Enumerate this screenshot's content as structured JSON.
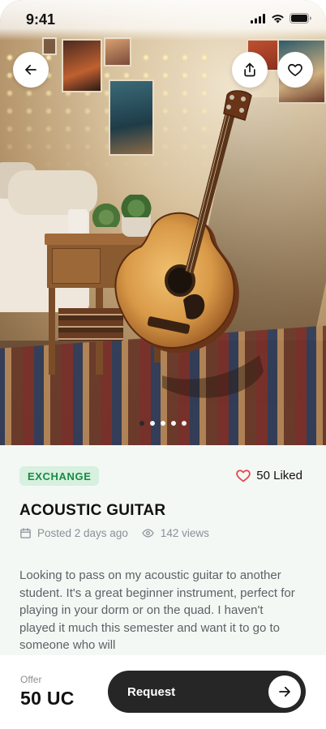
{
  "status_bar": {
    "time": "9:41"
  },
  "hero": {
    "image_subject": "acoustic guitar leaning against a dorm room wall",
    "carousel": {
      "count": 5,
      "active_index": 0
    },
    "icons": {
      "back": "arrow-left-icon",
      "share": "share-icon",
      "favorite": "heart-icon"
    }
  },
  "listing": {
    "badge": "EXCHANGE",
    "liked_label": "50 Liked",
    "title": "ACOUSTIC GUITAR",
    "posted": "Posted 2 days ago",
    "views": "142 views",
    "description": "Looking to pass on my acoustic guitar to another student. It's a great beginner instrument, perfect for playing in your dorm or on the quad. I haven't played it much this semester and want it to go to someone who will"
  },
  "footer": {
    "offer_label": "Offer",
    "offer_value": "50 UC",
    "request_label": "Request"
  },
  "colors": {
    "badge_bg": "#d7f0df",
    "badge_text": "#1a8a44",
    "heart": "#e5484d",
    "cta_bg": "#262626",
    "details_bg": "#f3f8f5"
  }
}
